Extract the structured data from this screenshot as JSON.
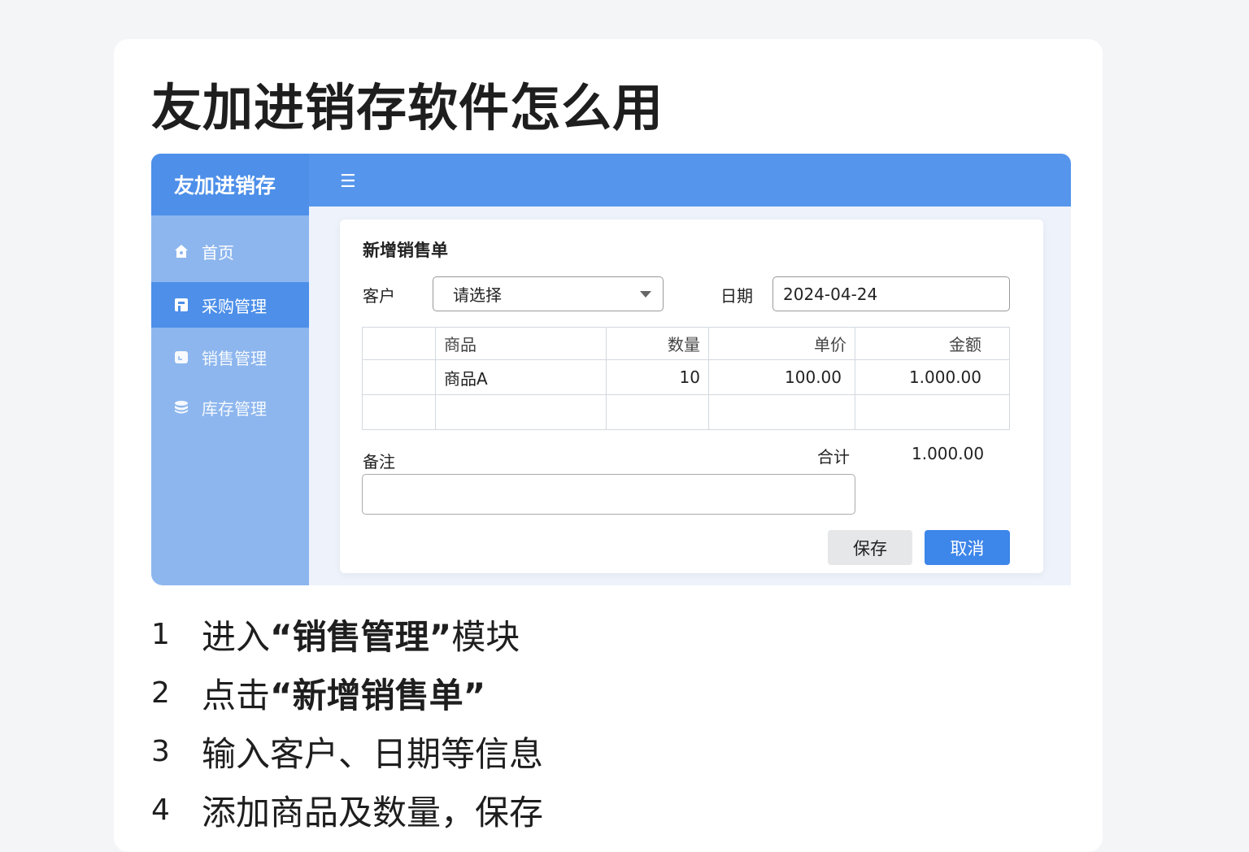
{
  "page_title": "友加进销存软件怎么用",
  "colors": {
    "brand": "#4d8fe9",
    "topbar": "#5595ec",
    "sidebar": "#8db6ee",
    "primary_button": "#3d86ea"
  },
  "app": {
    "brand": "友加进销存",
    "menu_icon": "hamburger-icon",
    "sidebar": [
      {
        "label": "首页",
        "icon": "home-icon"
      },
      {
        "label": "采购管理",
        "icon": "document-icon",
        "active": true
      },
      {
        "label": "销售管理",
        "icon": "calendar-icon"
      },
      {
        "label": "库存管理",
        "icon": "database-icon"
      }
    ],
    "form": {
      "title": "新增销售单",
      "customer_label": "客户",
      "customer_value": "请选择",
      "date_label": "日期",
      "date_value": "2024-04-24",
      "columns": [
        "",
        "商品",
        "数量",
        "单价",
        "金额"
      ],
      "rows": [
        [
          "",
          "商品A",
          "10",
          "100.00",
          "1.000.00"
        ],
        [
          "",
          "",
          "",
          "",
          ""
        ]
      ],
      "remark_label": "备注",
      "remark_value": "",
      "total_label": "合计",
      "total_value": "1.000.00",
      "save_label": "保存",
      "cancel_label": "取消"
    }
  },
  "steps": [
    {
      "num": "1",
      "pre": "进入",
      "bold": "“销售管理”",
      "post": " 模块"
    },
    {
      "num": "2",
      "pre": "点击",
      "bold": "“新增销售单”",
      "post": ""
    },
    {
      "num": "3",
      "pre": "输入客户、日期等信息",
      "bold": "",
      "post": ""
    },
    {
      "num": "4",
      "pre": "添加商品及数量，保存",
      "bold": "",
      "post": ""
    }
  ]
}
